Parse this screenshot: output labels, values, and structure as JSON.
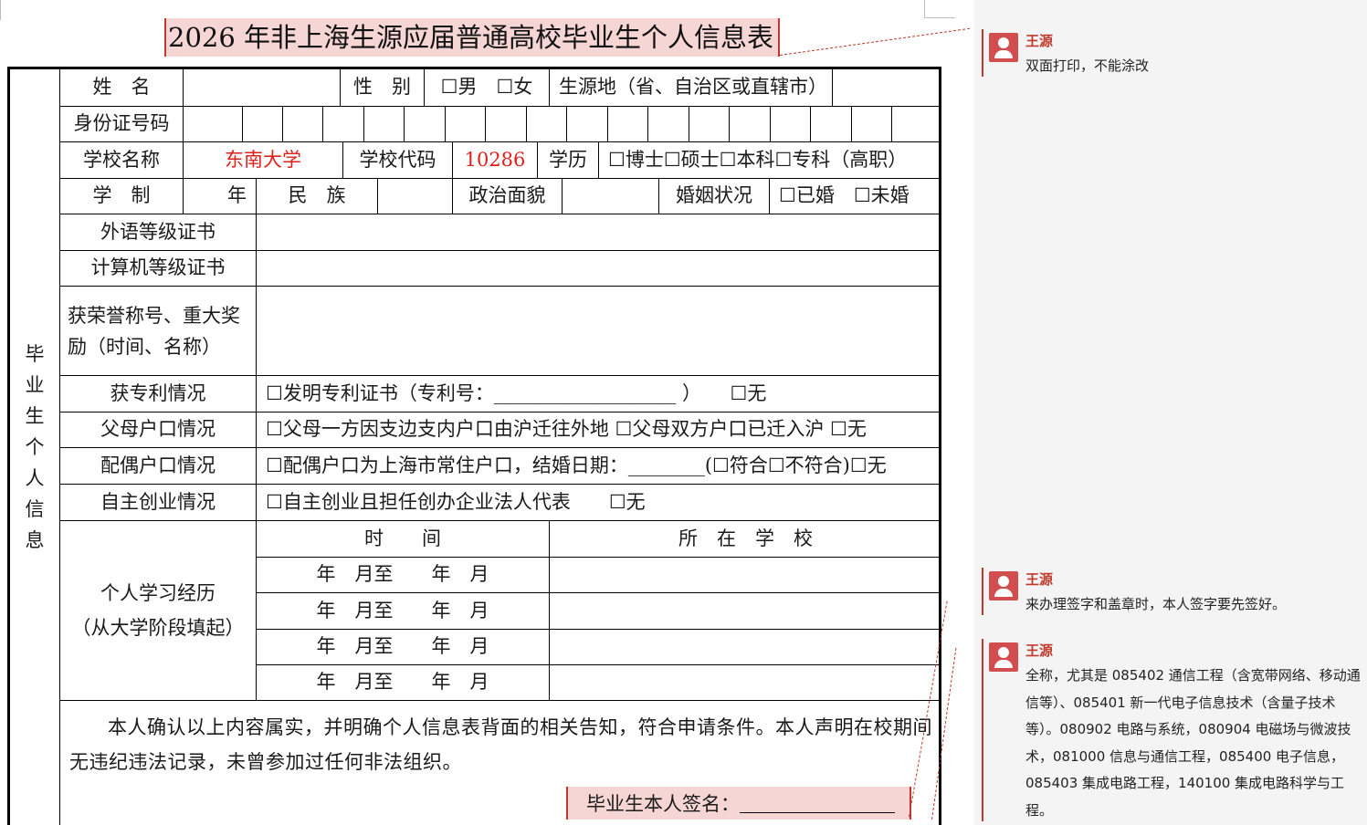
{
  "title": "2026 年非上海生源应届普通高校毕业生个人信息表",
  "side_label": [
    "毕",
    "业",
    "生",
    "个",
    "人",
    "信",
    "息"
  ],
  "row1": {
    "name_label": "姓　名",
    "gender_label": "性　别",
    "gender_options": "☐男　☐女",
    "origin_label": "生源地（省、自治区或直辖市）"
  },
  "row2": {
    "id_label": "身份证号码"
  },
  "row3": {
    "school_label": "学校名称",
    "school_value": "东南大学",
    "code_label": "学校代码",
    "code_value": "10286",
    "degree_label": "学历",
    "degree_options": "☐博士☐硕士☐本科☐专科（高职）"
  },
  "row4": {
    "duration_label": "学　制",
    "year_unit": "年",
    "ethnic_label": "民　族",
    "political_label": "政治面貌",
    "marital_label": "婚姻状况",
    "marital_options": "☐已婚　☐未婚"
  },
  "row5": {
    "language_label": "外语等级证书"
  },
  "row6": {
    "computer_label": "计算机等级证书"
  },
  "row7": {
    "awards_label": "获荣誉称号、重大奖励（时间、名称）"
  },
  "row8": {
    "patent_label": "获专利情况",
    "patent_text": "☐发明专利证书（专利号：___________________ ）　　☐无"
  },
  "row9": {
    "parents_label": "父母户口情况",
    "parents_text": "☐父母一方因支边支内户口由沪迁往外地 ☐父母双方户口已迁入沪 ☐无"
  },
  "row10": {
    "spouse_label": "配偶户口情况",
    "spouse_text": "☐配偶户口为上海市常住户口，结婚日期：________(☐符合☐不符合)☐无"
  },
  "row11": {
    "startup_label": "自主创业情况",
    "startup_text": "☐自主创业且担任创办企业法人代表　　☐无"
  },
  "study": {
    "label_line1": "个人学习经历",
    "label_line2": "（从大学阶段填起）",
    "time_header": "时　　间",
    "school_header": "所　在　学　校",
    "rows": [
      "年　月至　　年　月",
      "年　月至　　年　月",
      "年　月至　　年　月",
      "年　月至　　年　月"
    ]
  },
  "declaration": "本人确认以上内容属实，并明确个人信息表背面的相关告知，符合申请条件。本人声明在校期间无违纪违法记录，未曾参加过任何非法组织。",
  "signature_label": "毕业生本人签名：",
  "comments": [
    {
      "author": "王源",
      "text": "双面打印，不能涂改"
    },
    {
      "author": "王源",
      "text": "来办理签字和盖章时，本人签字要先签好。"
    },
    {
      "author": "王源",
      "text": "全称，尤其是 085402 通信工程（含宽带网络、移动通信等）、085401 新一代电子信息技术（含量子技术等）。080902 电路与系统，080904 电磁场与微波技术，081000 信息与通信工程，085400 电子信息，085403 集成电路工程，140100 集成电路科学与工程。"
    }
  ],
  "colors": {
    "highlight": "#f6d5d5",
    "accent": "#c0392b",
    "red_text": "#e0201b"
  }
}
